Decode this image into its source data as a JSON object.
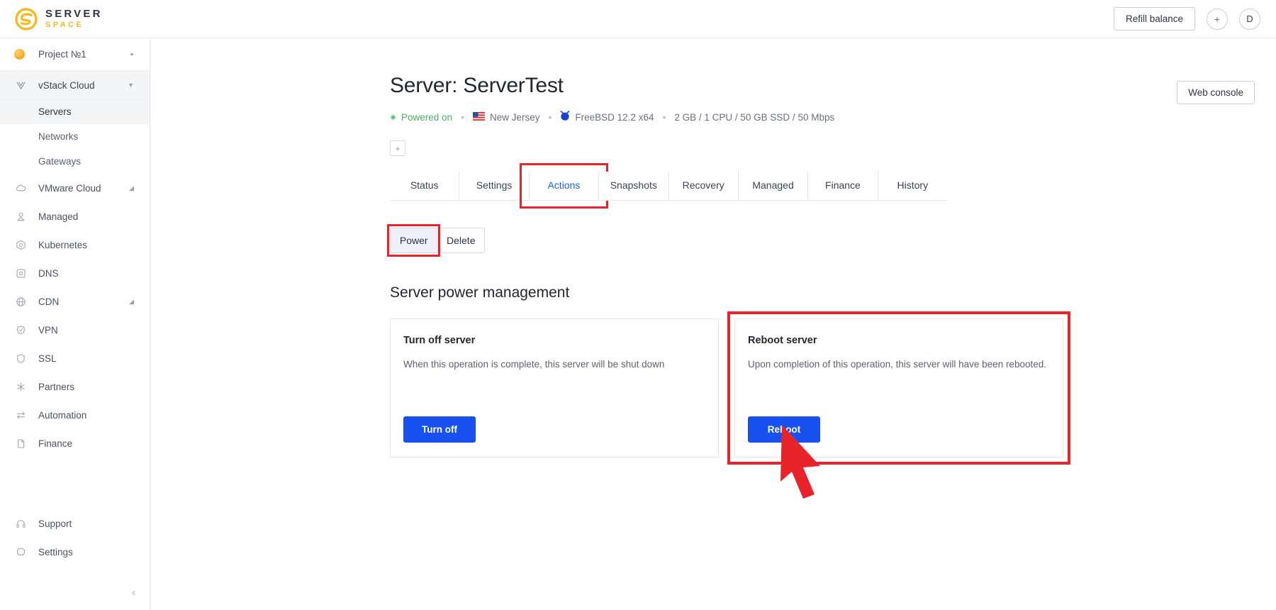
{
  "header": {
    "logo_top": "SERVER",
    "logo_bottom": "SPACE",
    "logo_icon": "serverspace-s-logo-icon",
    "refill_label": "Refill balance",
    "plus_icon": "plus-circle-icon",
    "plus_glyph": "+",
    "avatar_initial": "D"
  },
  "sidebar": {
    "project": {
      "label": "Project №1",
      "icon": "project-circle-icon",
      "caret": "▸"
    },
    "group": {
      "label": "vStack Cloud",
      "icon": "vstack-icon",
      "caret": "▼"
    },
    "sub_items": [
      {
        "label": "Servers",
        "active": true
      },
      {
        "label": "Networks",
        "active": false
      },
      {
        "label": "Gateways",
        "active": false
      }
    ],
    "items": [
      {
        "label": "VMware Cloud",
        "icon": "cloud-icon",
        "caret": "◢"
      },
      {
        "label": "Managed",
        "icon": "user-shield-icon",
        "caret": ""
      },
      {
        "label": "Kubernetes",
        "icon": "kubernetes-icon",
        "caret": ""
      },
      {
        "label": "DNS",
        "icon": "dns-square-icon",
        "caret": ""
      },
      {
        "label": "CDN",
        "icon": "globe-icon",
        "caret": "◢"
      },
      {
        "label": "VPN",
        "icon": "vpn-badge-icon",
        "caret": ""
      },
      {
        "label": "SSL",
        "icon": "shield-icon",
        "caret": ""
      },
      {
        "label": "Partners",
        "icon": "asterisk-icon",
        "caret": ""
      },
      {
        "label": "Automation",
        "icon": "automation-arrows-icon",
        "caret": ""
      },
      {
        "label": "Finance",
        "icon": "document-icon",
        "caret": ""
      }
    ],
    "bottom_items": [
      {
        "label": "Support",
        "icon": "headset-icon"
      },
      {
        "label": "Settings",
        "icon": "gear-icon"
      }
    ],
    "collapse_icon": "chevron-left-icon",
    "collapse_glyph": "‹"
  },
  "page": {
    "title": "Server: ServerTest",
    "web_console_label": "Web console",
    "add_tag_glyph": "+",
    "meta": {
      "status": "Powered on",
      "status_color": "#4caf6d",
      "location": "New Jersey",
      "location_icon": "us-flag-icon",
      "os": "FreeBSD 12.2 x64",
      "os_icon": "freebsd-daemon-icon",
      "specs": "2 GB / 1 CPU / 50 GB SSD / 50 Mbps",
      "separator": "•"
    }
  },
  "tabs": [
    {
      "label": "Status",
      "active": false,
      "highlighted": false
    },
    {
      "label": "Settings",
      "active": false,
      "highlighted": false
    },
    {
      "label": "Actions",
      "active": true,
      "highlighted": true
    },
    {
      "label": "Snapshots",
      "active": false,
      "highlighted": false
    },
    {
      "label": "Recovery",
      "active": false,
      "highlighted": false
    },
    {
      "label": "Managed",
      "active": false,
      "highlighted": false
    },
    {
      "label": "Finance",
      "active": false,
      "highlighted": false
    },
    {
      "label": "History",
      "active": false,
      "highlighted": false
    }
  ],
  "sub_tabs": [
    {
      "label": "Power",
      "active": true,
      "highlighted": true
    },
    {
      "label": "Delete",
      "active": false,
      "highlighted": false
    }
  ],
  "section": {
    "title": "Server power management"
  },
  "cards": [
    {
      "title": "Turn off server",
      "desc": "When this operation is complete, this server will be shut down",
      "button": "Turn off",
      "highlighted": false
    },
    {
      "title": "Reboot server",
      "desc": "Upon completion of this operation, this server will have been rebooted.",
      "button": "Reboot",
      "highlighted": true
    }
  ],
  "annotations": {
    "highlight_color": "#e8232a",
    "cursor_icon": "red-cursor-arrow-icon",
    "accent_blue": "#1851f0",
    "tab_active_blue": "#2060e8"
  }
}
